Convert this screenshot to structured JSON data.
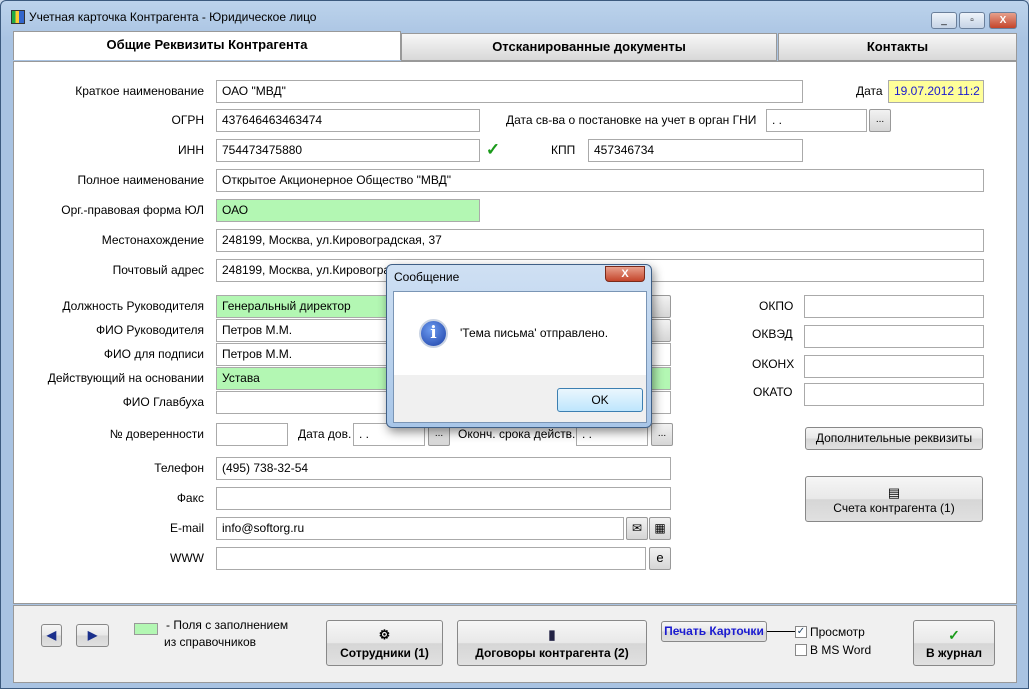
{
  "window": {
    "title": "Учетная карточка Контрагента - Юридическое лицо",
    "min": "_",
    "max": "▫",
    "close": "X"
  },
  "tabs": [
    {
      "label": "Общие Реквизиты Контрагента"
    },
    {
      "label": "Отсканированные документы"
    },
    {
      "label": "Контакты"
    }
  ],
  "form": {
    "short_name": {
      "label": "Краткое наименование",
      "value": "ОАО \"МВД\""
    },
    "date": {
      "label": "Дата",
      "value": "19.07.2012 11:2"
    },
    "ogrn": {
      "label": "ОГРН",
      "value": "437646463463474"
    },
    "reg_date": {
      "label": "Дата св-ва о постановке на учет в орган ГНИ",
      "value": " .  ."
    },
    "inn": {
      "label": "ИНН",
      "value": "754473475880"
    },
    "kpp": {
      "label": "КПП",
      "value": "457346734"
    },
    "full_name": {
      "label": "Полное наименование",
      "value": "Открытое Акционерное Общество \"МВД\""
    },
    "org_form": {
      "label": "Орг.-правовая форма ЮЛ",
      "value": "ОАО"
    },
    "location": {
      "label": "Местонахождение",
      "value": "248199, Москва, ул.Кировоградская, 37"
    },
    "postal": {
      "label": "Почтовый адрес",
      "value": "248199, Москва, ул.Кировоградская, 37"
    },
    "head_position": {
      "label": "Должность Руководителя",
      "value": "Генеральный директор"
    },
    "head_name": {
      "label": "ФИО Руководителя",
      "value": "Петров М.М."
    },
    "sign_name": {
      "label": "ФИО для подписи",
      "value": "Петров М.М."
    },
    "basis": {
      "label": "Действующий на основании",
      "value": "Устава"
    },
    "accountant": {
      "label": "ФИО Главбуха",
      "value": ""
    },
    "poa_no": {
      "label": "№ доверенности",
      "value": ""
    },
    "poa_date": {
      "label": "Дата дов.",
      "value": " .  ."
    },
    "poa_end": {
      "label": "Оконч. срока действ.",
      "value": " .  ."
    },
    "phone": {
      "label": "Телефон",
      "value": "(495) 738-32-54"
    },
    "fax": {
      "label": "Факс",
      "value": ""
    },
    "email": {
      "label": "E-mail",
      "value": "info@softorg.ru"
    },
    "www": {
      "label": "WWW",
      "value": ""
    },
    "okpo": {
      "label": "ОКПО",
      "value": ""
    },
    "okved": {
      "label": "ОКВЭД",
      "value": ""
    },
    "okonh": {
      "label": "ОКОНХ",
      "value": ""
    },
    "okato": {
      "label": "ОКАТО",
      "value": ""
    },
    "dots": "...",
    "extra_button": "Дополнительные реквизиты",
    "accounts_button": "Счета контрагента (1)"
  },
  "bottom": {
    "legend": "-  Поля с заполнением",
    "legend2": "из справочников",
    "employees": "Сотрудники (1)",
    "contracts": "Договоры контрагента (2)",
    "print": "Печать Карточки",
    "preview": "Просмотр",
    "preview_checked": true,
    "msword": "В MS Word",
    "msword_checked": false,
    "journal": "В журнал",
    "prev": "◀",
    "next": "▶"
  },
  "dialog": {
    "title": "Сообщение",
    "message": "'Тема письма' отправлено.",
    "ok": "OK",
    "close": "X"
  },
  "colors": {
    "lookup_field": "#b3f7b3",
    "date_field": "#ffff99",
    "accent": "#1a1ad0"
  }
}
